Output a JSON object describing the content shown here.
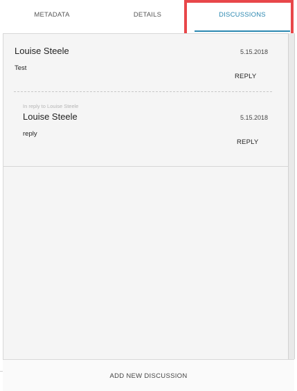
{
  "tabs": [
    {
      "label": "METADATA"
    },
    {
      "label": "DETAILS"
    },
    {
      "label": "DISCUSSIONS",
      "active": true
    }
  ],
  "colors": {
    "accent": "#2a87b0",
    "highlight": "#e8474a"
  },
  "discussion": {
    "comment": {
      "author": "Louise Steele",
      "date": "5.15.2018",
      "text": "Test",
      "reply_label": "REPLY"
    },
    "reply": {
      "context": "In reply to Louise Steele",
      "author": "Louise Steele",
      "date": "5.15.2018",
      "text": "reply",
      "reply_label": "REPLY"
    }
  },
  "footer": {
    "add_label": "ADD NEW DISCUSSION"
  }
}
